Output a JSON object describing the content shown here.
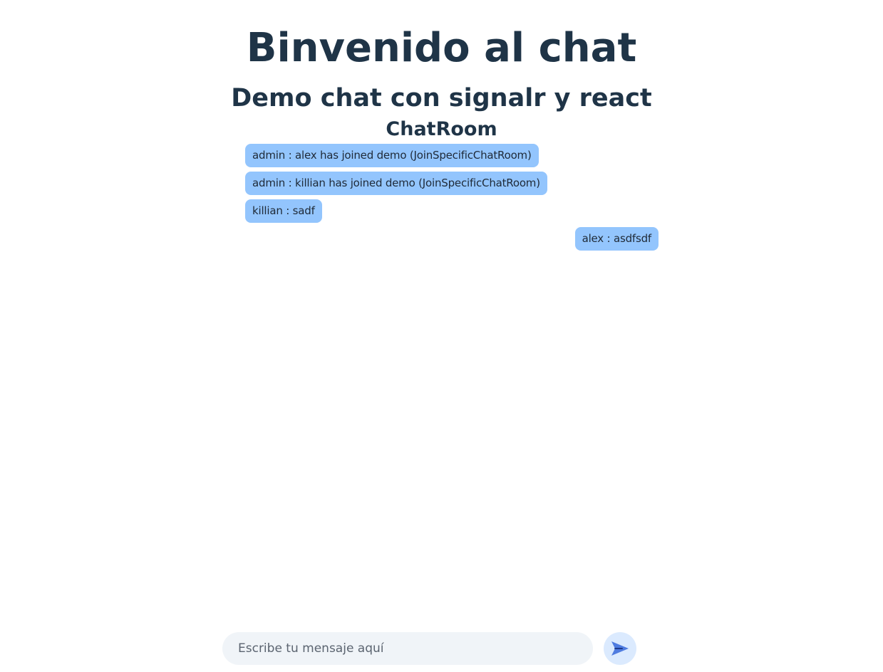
{
  "header": {
    "title": "Binvenido al chat",
    "subtitle": "Demo chat con signalr y react"
  },
  "chat": {
    "room_title": "ChatRoom",
    "messages": [
      {
        "text": "admin : alex has joined demo (JoinSpecificChatRoom)",
        "side": "left"
      },
      {
        "text": "admin : killian has joined demo (JoinSpecificChatRoom)",
        "side": "left"
      },
      {
        "text": "killian : sadf",
        "side": "left"
      },
      {
        "text": "alex : asdfsdf",
        "side": "right"
      }
    ]
  },
  "composer": {
    "placeholder": "Escribe tu mensaje aquí",
    "value": "",
    "send_icon": "send-icon"
  },
  "colors": {
    "heading": "#1f3447",
    "bubble": "#93c5fd",
    "input_bg": "#f0f4f8",
    "send_bg": "#dbeafe",
    "send_icon": "#4f7ce0"
  }
}
